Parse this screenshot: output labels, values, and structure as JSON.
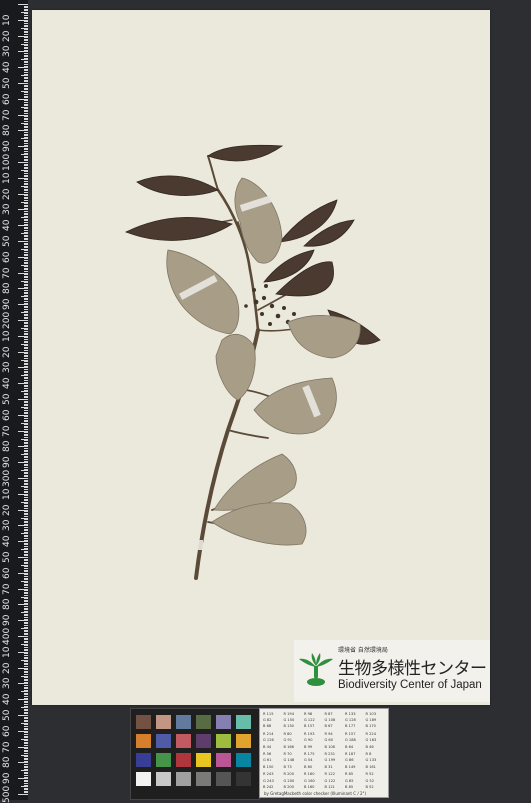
{
  "ruler": {
    "unit": "mm",
    "scale_labels": [
      "10",
      "20",
      "30",
      "40",
      "50",
      "60",
      "70",
      "80",
      "90",
      "100",
      "10",
      "20",
      "30",
      "40",
      "50",
      "60",
      "70",
      "80",
      "90",
      "200",
      "10",
      "20",
      "30",
      "40",
      "50",
      "60",
      "70",
      "80",
      "90",
      "300",
      "10",
      "20",
      "30",
      "40",
      "50",
      "60",
      "70",
      "80",
      "90",
      "400",
      "10",
      "20",
      "30",
      "40",
      "50",
      "60",
      "70",
      "80",
      "90",
      "500"
    ]
  },
  "logo": {
    "agency": "環境省 自然環境局",
    "name_jp": "生物多様性センター",
    "name_en": "Biodiversity Center of Japan",
    "brand_color": "#2e8f3c"
  },
  "color_checker": {
    "patches": [
      "#735244",
      "#c29682",
      "#627a9d",
      "#576c43",
      "#8580b1",
      "#67bdaa",
      "#d67e2c",
      "#505ba6",
      "#c15a63",
      "#5e3c6c",
      "#9dbc40",
      "#e0a32e",
      "#383d96",
      "#469449",
      "#af363c",
      "#e7c71f",
      "#bb5695",
      "#0885a1",
      "#f3f3f2",
      "#c8c8c8",
      "#a0a0a0",
      "#7a7a79",
      "#555555",
      "#343434"
    ]
  },
  "reference_table": {
    "rows": [
      [
        "R 115",
        "R 194",
        "R 98",
        "R 87",
        "R 133",
        "R 103"
      ],
      [
        "G 82",
        "G 150",
        "G 122",
        "G 108",
        "G 128",
        "G 189"
      ],
      [
        "B 68",
        "B 130",
        "B 157",
        "B 67",
        "B 177",
        "B 170"
      ],
      [
        "R 214",
        "R 80",
        "R 193",
        "R 94",
        "R 157",
        "R 224"
      ],
      [
        "G 126",
        "G 91",
        "G 90",
        "G 60",
        "G 188",
        "G 163"
      ],
      [
        "B 44",
        "B 166",
        "B 99",
        "B 108",
        "B 64",
        "B 46"
      ],
      [
        "R 56",
        "R 70",
        "R 175",
        "R 231",
        "R 187",
        "R 8"
      ],
      [
        "G 61",
        "G 148",
        "G 54",
        "G 199",
        "G 86",
        "G 133"
      ],
      [
        "B 150",
        "B 73",
        "B 60",
        "B 31",
        "B 149",
        "B 161"
      ],
      [
        "R 243",
        "R 200",
        "R 160",
        "R 122",
        "R 85",
        "R 52"
      ],
      [
        "G 243",
        "G 200",
        "G 160",
        "G 122",
        "G 85",
        "G 52"
      ],
      [
        "B 242",
        "B 200",
        "B 160",
        "B 121",
        "B 85",
        "B 52"
      ]
    ],
    "caption": "by GretagMacbeth color checker  (Illuminant C / 2°)"
  }
}
